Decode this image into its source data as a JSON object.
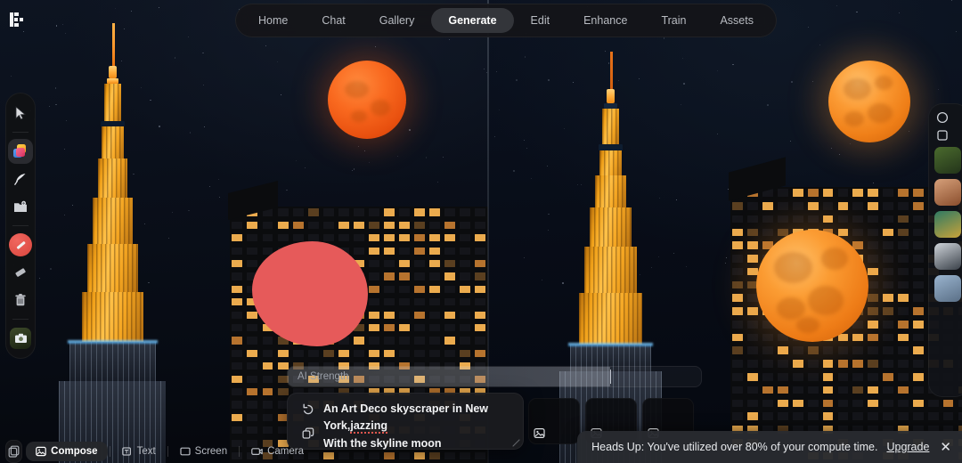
{
  "app": {
    "logo_name": "app-logo",
    "accent_red": "#e65a5a",
    "accent_moon_left": "#f9691f",
    "accent_moon_right": "#fb9a33",
    "panel_bg": "#141518"
  },
  "topnav": {
    "items": [
      {
        "label": "Home",
        "active": false,
        "name": "tab-home"
      },
      {
        "label": "Chat",
        "active": false,
        "name": "tab-chat"
      },
      {
        "label": "Gallery",
        "active": false,
        "name": "tab-gallery"
      },
      {
        "label": "Generate",
        "active": true,
        "name": "tab-generate"
      },
      {
        "label": "Edit",
        "active": false,
        "name": "tab-edit"
      },
      {
        "label": "Enhance",
        "active": false,
        "name": "tab-enhance"
      },
      {
        "label": "Train",
        "active": false,
        "name": "tab-train"
      },
      {
        "label": "Assets",
        "active": false,
        "name": "tab-assets"
      }
    ]
  },
  "left_toolbar": {
    "tools": [
      {
        "icon": "cursor-icon",
        "name": "tool-select",
        "selected": false
      },
      {
        "icon": "layers-icon",
        "name": "tool-layers",
        "selected": true
      },
      {
        "icon": "feather-icon",
        "name": "tool-feather",
        "selected": false
      },
      {
        "icon": "image-add-icon",
        "name": "tool-add-image",
        "selected": false
      },
      {
        "icon": "brush-mask-icon",
        "name": "tool-mask-brush",
        "selected": false
      },
      {
        "icon": "eraser-icon",
        "name": "tool-eraser",
        "selected": false
      },
      {
        "icon": "trash-icon",
        "name": "tool-delete",
        "selected": false
      },
      {
        "icon": "photo-chip-icon",
        "name": "tool-reference",
        "selected": false
      }
    ]
  },
  "right_panel": {
    "icons": [
      "more-icon",
      "frame-icon"
    ],
    "thumbnails": [
      {
        "name": "asset-thumb-1",
        "colors": [
          "#4b6b2e",
          "#23341a"
        ]
      },
      {
        "name": "asset-thumb-2",
        "colors": [
          "#d6a07a",
          "#8a4e2d"
        ]
      },
      {
        "name": "asset-thumb-3",
        "colors": [
          "#2e7a63",
          "#c8a23a"
        ]
      },
      {
        "name": "asset-thumb-4",
        "colors": [
          "#cfd4da",
          "#3a4149"
        ]
      },
      {
        "name": "asset-thumb-5",
        "colors": [
          "#9ab4cf",
          "#5a6f86"
        ]
      }
    ]
  },
  "ai_strength": {
    "label": "AI Strength",
    "value_percent": 78
  },
  "prompt": {
    "line1": "An Art Deco skyscraper in New",
    "line2": "York,",
    "line2_misspelled": "jazzing",
    "line3": "With the skyline moon",
    "undo_icon": "undo-icon",
    "duplicate_icon": "duplicate-icon",
    "resize_icon": "resize-handle-icon"
  },
  "results": {
    "cards": [
      {
        "name": "result-card-1",
        "icon": "image-placeholder-icon"
      },
      {
        "name": "result-card-2",
        "icon": "image-placeholder-icon"
      },
      {
        "name": "result-card-3",
        "icon": "image-placeholder-icon"
      }
    ]
  },
  "bottom_bar": {
    "grid_icon": "grid-icon",
    "items": [
      {
        "label": "Compose",
        "icon": "compose-icon",
        "active": true,
        "name": "mode-compose"
      },
      {
        "label": "Text",
        "icon": "text-icon",
        "active": false,
        "name": "mode-text"
      },
      {
        "label": "Screen",
        "icon": "screen-icon",
        "active": false,
        "name": "mode-screen"
      },
      {
        "label": "Camera",
        "icon": "camera-icon",
        "active": false,
        "name": "mode-camera"
      }
    ]
  },
  "toast": {
    "message": "Heads Up: You've utilized over 80% of your compute time.",
    "link": "Upgrade",
    "close": "✕"
  },
  "canvas": {
    "left_image_alt": "Art Deco skyscraper at night with orange moon and red mask selection",
    "right_image_alt": "Generated result: skyscraper at night with second moon on building facade"
  }
}
